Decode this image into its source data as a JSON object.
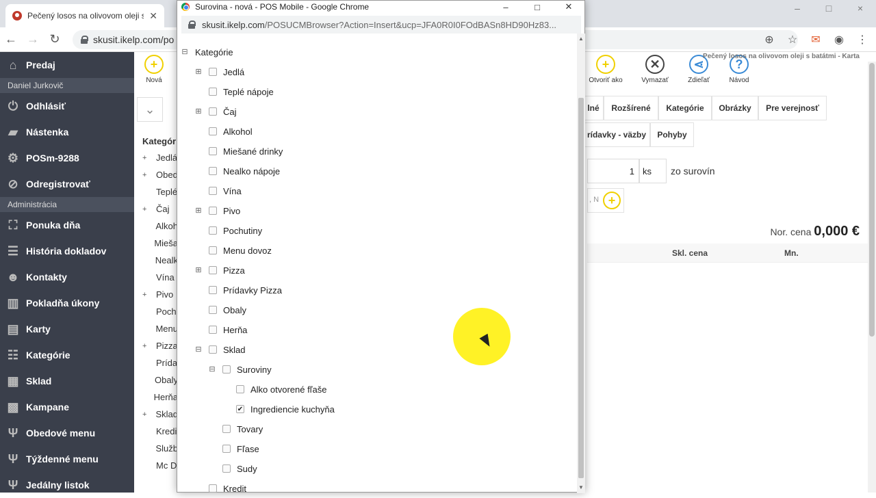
{
  "main_window": {
    "tab_title": "Pečený losos na olivovom oleji s batátmi - Karta",
    "tab_title_short": "Pečený losos na olivovom oleji s b",
    "url_partial": "skusit.ikelp.com/po",
    "window_controls": [
      "–",
      "□",
      "×"
    ]
  },
  "sidebar": {
    "items": [
      {
        "label": "Predaj",
        "icon": "home-icon",
        "glyph": "⌂"
      },
      {
        "label": "Daniel Jurkovič",
        "type": "sub"
      },
      {
        "label": "Odhlásiť",
        "icon": "power-icon",
        "glyph": "⏻"
      },
      {
        "label": "Nástenka",
        "icon": "dashboard-icon",
        "glyph": "▰"
      },
      {
        "label": "POSm-9288",
        "icon": "gear-icon",
        "glyph": "⚙"
      },
      {
        "label": "Odregistrovať",
        "icon": "ban-icon",
        "glyph": "⊘"
      },
      {
        "label": "Administrácia",
        "type": "sub"
      },
      {
        "label": "Ponuka dňa",
        "icon": "boxes-star-icon",
        "glyph": "⛶"
      },
      {
        "label": "História dokladov",
        "icon": "list-icon",
        "glyph": "☰"
      },
      {
        "label": "Kontakty",
        "icon": "users-icon",
        "glyph": "☻"
      },
      {
        "label": "Pokladňa úkony",
        "icon": "columns-icon",
        "glyph": "▥"
      },
      {
        "label": "Karty",
        "icon": "cards-icon",
        "glyph": "▤"
      },
      {
        "label": "Kategórie",
        "icon": "sitemap-icon",
        "glyph": "☷"
      },
      {
        "label": "Sklad",
        "icon": "warehouse-icon",
        "glyph": "▦"
      },
      {
        "label": "Kampane",
        "icon": "campaign-icon",
        "glyph": "▩"
      },
      {
        "label": "Obedové menu",
        "icon": "cutlery-icon",
        "glyph": "Ψ"
      },
      {
        "label": "Týždenné menu",
        "icon": "cutlery-icon",
        "glyph": "Ψ"
      },
      {
        "label": "Jedálny listok",
        "icon": "cutlery-icon",
        "glyph": "Ψ"
      }
    ]
  },
  "app": {
    "toolbar": {
      "new_label": "Nová",
      "open_as_label": "Otvoriť ako",
      "delete_label": "Vymazať",
      "share_label": "Zdieľať",
      "help_label": "Návod"
    },
    "breadcrumb_right": "Pečený losos na olivovom oleji s batátmi - Karta",
    "tree_header": "Kategór",
    "bg_tree": [
      {
        "label": "Jedlá",
        "expand": "+"
      },
      {
        "label": "Obed",
        "expand": "+"
      },
      {
        "label": "Teplé",
        "expand": ""
      },
      {
        "label": "Čaj",
        "expand": "+"
      },
      {
        "label": "Alkoh",
        "expand": ""
      },
      {
        "label": "Mieša",
        "expand": ""
      },
      {
        "label": "Nealk",
        "expand": ""
      },
      {
        "label": "Vína",
        "expand": ""
      },
      {
        "label": "Pivo",
        "expand": "+"
      },
      {
        "label": "Poch",
        "expand": ""
      },
      {
        "label": "Menu",
        "expand": ""
      },
      {
        "label": "Pizza",
        "expand": "+"
      },
      {
        "label": "Prída",
        "expand": ""
      },
      {
        "label": "Obaly",
        "expand": ""
      },
      {
        "label": "Herňa",
        "expand": ""
      },
      {
        "label": "Sklad",
        "expand": "+"
      },
      {
        "label": "Kredi",
        "expand": ""
      },
      {
        "label": "Služb",
        "expand": ""
      },
      {
        "label": "Mc D",
        "expand": ""
      }
    ],
    "tabs_row1": [
      "lné",
      "Rozšírené",
      "Kategórie",
      "Obrázky",
      "Pre verejnosť"
    ],
    "tabs_row2": [
      "rídavky - väzby",
      "Pohyby"
    ],
    "qty_value": "1",
    "qty_unit": "ks",
    "qty_suffix": "zo surovín",
    "add_field_partial": ", N",
    "nor_cena_label": "Nor. cena",
    "nor_cena_value": "0,000 €",
    "table_headers": [
      "Skl. cena",
      "Mn."
    ]
  },
  "popup": {
    "title": "Surovina - nová - POS Mobile - Google Chrome",
    "url_host": "skusit.ikelp.com",
    "url_path": "/POSUCMBrowser?Action=Insert&ucp=JFA0R0I0FOdBASn8HD90Hz83...",
    "tree": [
      {
        "label": "Kategórie",
        "level": 0,
        "toggle": "minus",
        "checkbox": false,
        "checked": false
      },
      {
        "label": "Jedlá",
        "level": 1,
        "toggle": "plus",
        "checkbox": true,
        "checked": false
      },
      {
        "label": "Teplé nápoje",
        "level": 1,
        "toggle": "",
        "checkbox": true,
        "checked": false
      },
      {
        "label": "Čaj",
        "level": 1,
        "toggle": "plus",
        "checkbox": true,
        "checked": false
      },
      {
        "label": "Alkohol",
        "level": 1,
        "toggle": "",
        "checkbox": true,
        "checked": false
      },
      {
        "label": "Miešané drinky",
        "level": 1,
        "toggle": "",
        "checkbox": true,
        "checked": false
      },
      {
        "label": "Nealko nápoje",
        "level": 1,
        "toggle": "",
        "checkbox": true,
        "checked": false
      },
      {
        "label": "Vína",
        "level": 1,
        "toggle": "",
        "checkbox": true,
        "checked": false
      },
      {
        "label": "Pivo",
        "level": 1,
        "toggle": "plus",
        "checkbox": true,
        "checked": false
      },
      {
        "label": "Pochutiny",
        "level": 1,
        "toggle": "",
        "checkbox": true,
        "checked": false
      },
      {
        "label": "Menu dovoz",
        "level": 1,
        "toggle": "",
        "checkbox": true,
        "checked": false
      },
      {
        "label": "Pizza",
        "level": 1,
        "toggle": "plus",
        "checkbox": true,
        "checked": false
      },
      {
        "label": "Prídavky Pizza",
        "level": 1,
        "toggle": "",
        "checkbox": true,
        "checked": false
      },
      {
        "label": "Obaly",
        "level": 1,
        "toggle": "",
        "checkbox": true,
        "checked": false
      },
      {
        "label": "Herňa",
        "level": 1,
        "toggle": "",
        "checkbox": true,
        "checked": false
      },
      {
        "label": "Sklad",
        "level": 1,
        "toggle": "minus",
        "checkbox": true,
        "checked": false
      },
      {
        "label": "Suroviny",
        "level": 2,
        "toggle": "minus",
        "checkbox": true,
        "checked": false
      },
      {
        "label": "Alko otvorené fľaše",
        "level": 3,
        "toggle": "",
        "checkbox": true,
        "checked": false
      },
      {
        "label": "Ingrediencie kuchyňa",
        "level": 3,
        "toggle": "",
        "checkbox": true,
        "checked": true
      },
      {
        "label": "Tovary",
        "level": 2,
        "toggle": "",
        "checkbox": true,
        "checked": false
      },
      {
        "label": "Fľase",
        "level": 2,
        "toggle": "",
        "checkbox": true,
        "checked": false
      },
      {
        "label": "Sudy",
        "level": 2,
        "toggle": "",
        "checkbox": true,
        "checked": false
      },
      {
        "label": "Kredit",
        "level": 1,
        "toggle": "",
        "checkbox": true,
        "checked": false
      }
    ]
  },
  "colors": {
    "sidebar_bg": "#3a3f4b",
    "accent_yellow": "#f0d000",
    "cursor_highlight": "#fff000"
  }
}
